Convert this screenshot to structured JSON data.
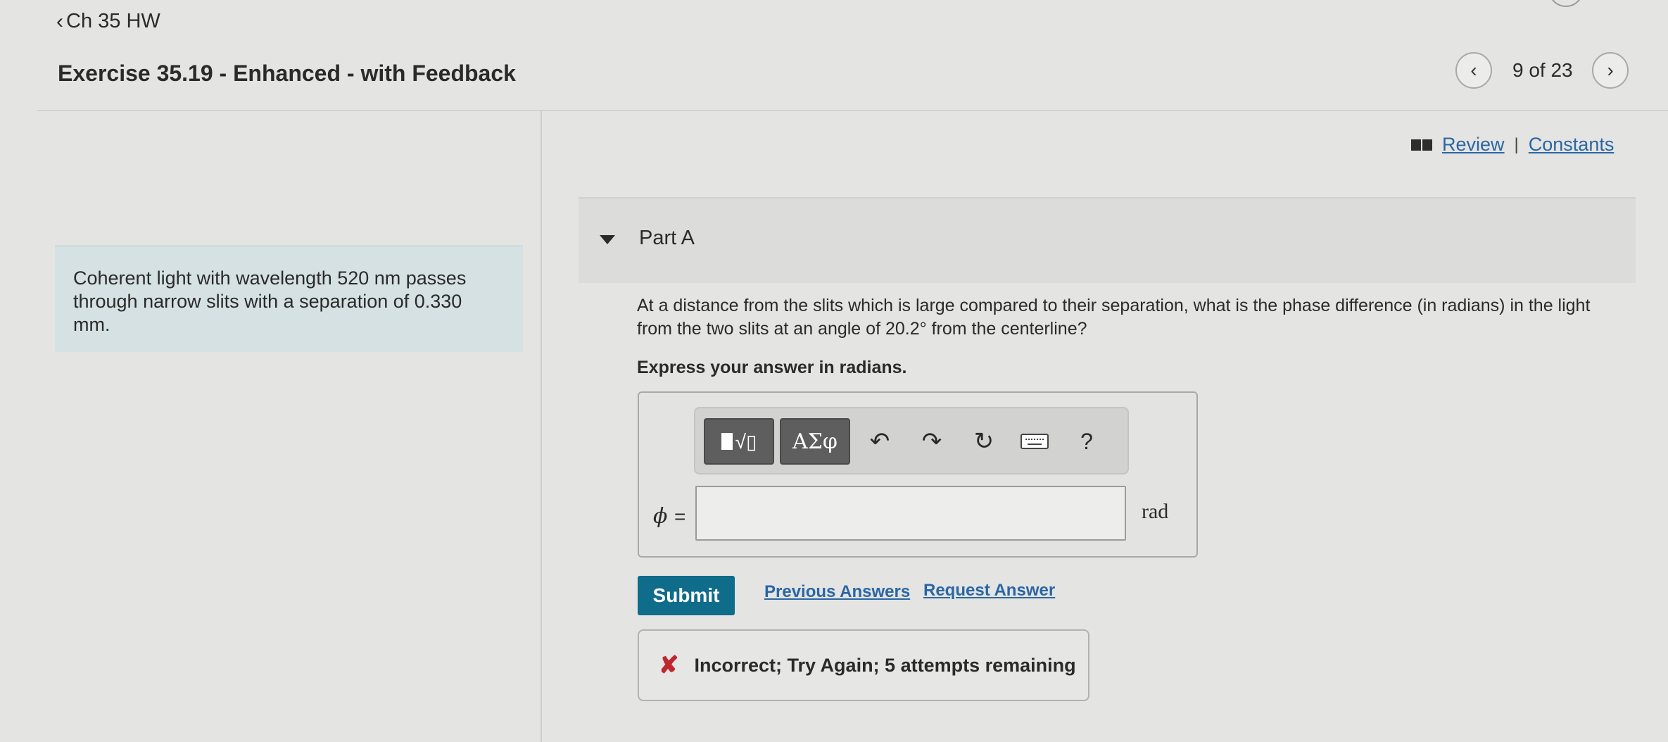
{
  "header": {
    "back_label": "Ch 35 HW",
    "title": "Exercise 35.19 - Enhanced - with Feedback",
    "position": "9 of 23",
    "prev_icon": "chevron-left-icon",
    "next_icon": "chevron-right-icon"
  },
  "resources": {
    "review_label": "Review",
    "separator": "|",
    "constants_label": "Constants"
  },
  "intro": {
    "text": "Coherent light with wavelength 520 nm passes through narrow slits with a separation of 0.330 mm."
  },
  "part": {
    "label": "Part A",
    "question": "At a distance from the slits which is large compared to their separation, what is the phase difference (in radians) in the light from the two slits at an angle of 20.2° from the centerline?",
    "instruction": "Express your answer in radians."
  },
  "toolbar": {
    "greek_label": "ΑΣφ",
    "help_label": "?",
    "icons": [
      "templates-icon",
      "greek-symbols-icon",
      "undo-icon",
      "redo-icon",
      "reset-icon",
      "keyboard-icon",
      "help-icon"
    ]
  },
  "answer": {
    "variable": "ϕ",
    "equals": "=",
    "value": "",
    "unit": "rad"
  },
  "actions": {
    "submit_label": "Submit",
    "previous_answers_label": "Previous Answers",
    "request_answer_label": "Request Answer"
  },
  "feedback": {
    "icon": "x-mark-icon",
    "message": "Incorrect; Try Again; 5 attempts remaining",
    "color": "#c0262d"
  },
  "colors": {
    "link": "#2a66a5",
    "submit": "#0f6c8a",
    "intro_bg": "#d5e1e3"
  }
}
